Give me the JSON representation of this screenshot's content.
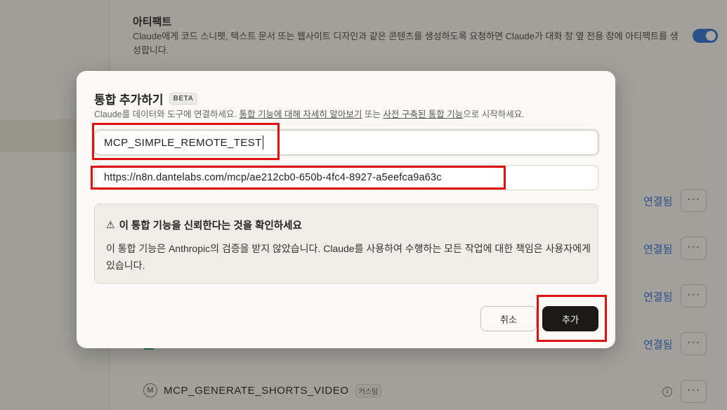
{
  "background": {
    "artifact_title": "아티팩트",
    "artifact_desc": "Claude에게 코드 스니펫, 텍스트 문서 또는 웹사이트 디자인과 같은 콘텐츠를 생성하도록 요청하면 Claude가 대화 창 옆 전용 창에 아티팩트를 생성합니다.",
    "connected_label": "연결됨",
    "more_label": "···",
    "bottom_item": {
      "initial": "M",
      "name": "MCP_GENERATE_SHORTS_VIDEO",
      "badge": "커스텀"
    }
  },
  "modal": {
    "title": "통합 추가하기",
    "beta": "BETA",
    "subtitle": {
      "prefix": "Claude를 데이터와 도구에 연결하세요. ",
      "link1": "통합 기능에 대해 자세히 알아보기",
      "middle": " 또는 ",
      "link2": "사전 구축된 통합 기능",
      "suffix": "으로 시작하세요."
    },
    "name_value": "MCP_SIMPLE_REMOTE_TEST",
    "url_value": "https://n8n.dantelabs.com/mcp/ae212cb0-650b-4fc4-8927-a5eefca9a63c",
    "warning_title": "이 통합 기능을 신뢰한다는 것을 확인하세요",
    "warning_body": "이 통합 기능은 Anthropic의 검증을 받지 않았습니다. Claude를 사용하여 수행하는 모든 작업에 대한 책임은 사용자에게 있습니다.",
    "cancel_label": "취소",
    "add_label": "추가"
  },
  "colors": {
    "link_blue": "#2f6fd6",
    "highlight_red": "#e01010",
    "primary_button": "#1b1a17"
  }
}
